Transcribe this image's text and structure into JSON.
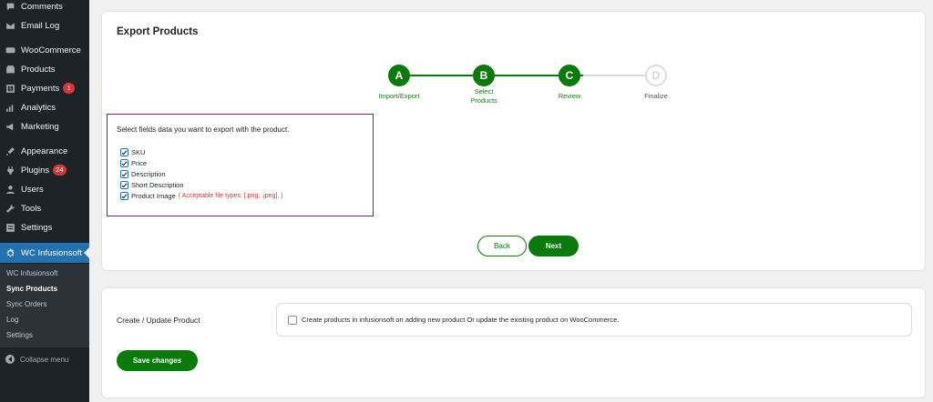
{
  "sidebar": {
    "items": [
      {
        "label": "Comments",
        "icon": "comment-icon"
      },
      {
        "label": "Email Log",
        "icon": "email-icon"
      },
      {
        "label": "WooCommerce",
        "icon": "woocommerce-icon"
      },
      {
        "label": "Products",
        "icon": "products-icon"
      },
      {
        "label": "Payments",
        "icon": "payments-icon",
        "badge": "1"
      },
      {
        "label": "Analytics",
        "icon": "analytics-icon"
      },
      {
        "label": "Marketing",
        "icon": "marketing-icon"
      },
      {
        "label": "Appearance",
        "icon": "appearance-icon"
      },
      {
        "label": "Plugins",
        "icon": "plugins-icon",
        "badge": "24"
      },
      {
        "label": "Users",
        "icon": "users-icon"
      },
      {
        "label": "Tools",
        "icon": "tools-icon"
      },
      {
        "label": "Settings",
        "icon": "settings-icon"
      },
      {
        "label": "WC Infusionsoft",
        "icon": "gear-icon"
      }
    ],
    "submenu": [
      {
        "label": "WC Infusionsoft"
      },
      {
        "label": "Sync Products"
      },
      {
        "label": "Sync Orders"
      },
      {
        "label": "Log"
      },
      {
        "label": "Settings"
      }
    ],
    "collapse_label": "Collapse menu"
  },
  "export": {
    "title": "Export Products",
    "steps": [
      {
        "letter": "A",
        "label": "Import/Export",
        "state": "done"
      },
      {
        "letter": "B",
        "label": "Select Products",
        "state": "done"
      },
      {
        "letter": "C",
        "label": "Review",
        "state": "done"
      },
      {
        "letter": "D",
        "label": "Finalize",
        "state": "todo"
      }
    ],
    "fields_heading": "Select fields data you want to export with the product.",
    "fields": [
      {
        "label": "SKU",
        "checked": true
      },
      {
        "label": "Price",
        "checked": true
      },
      {
        "label": "Description",
        "checked": true
      },
      {
        "label": "Short Description",
        "checked": true
      },
      {
        "label": "Product Image",
        "checked": true
      }
    ],
    "image_hint": "( Acceptable file types: [.png, .jpeg]. )",
    "back_label": "Back",
    "next_label": "Next"
  },
  "settings_card": {
    "label": "Create / Update Product",
    "option_text": "Create products in infusionsoft on adding new product Or update the existing product on WooCommerce.",
    "option_checked": false,
    "save_label": "Save changes"
  },
  "colors": {
    "sidebar_bg": "#1d2327",
    "active_menu": "#2271b1",
    "accent_green": "#0a7a0a",
    "highlight_border": "#7b1f7a",
    "hint_red": "#d63638"
  }
}
